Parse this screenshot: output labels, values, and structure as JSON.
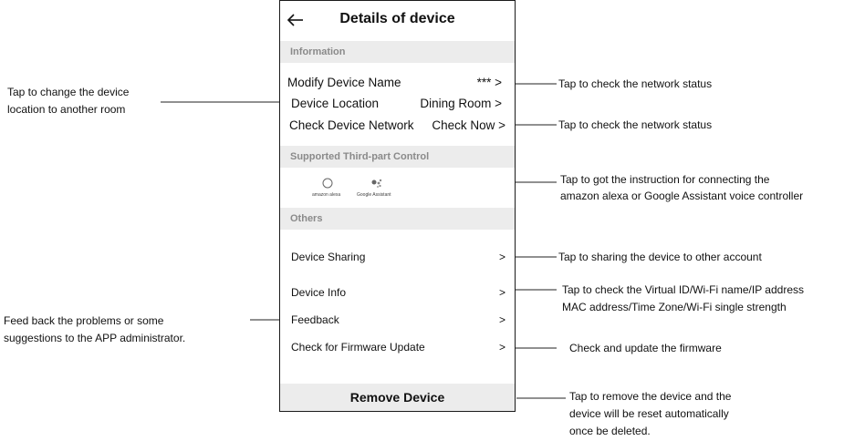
{
  "screen": {
    "title": "Details of device",
    "back_icon": "arrow-left-icon",
    "sections": {
      "information": "Information",
      "third_party": "Supported Third-part Control",
      "others": "Others"
    },
    "information_rows": [
      {
        "label": "Modify Device Name",
        "value": "*** >"
      },
      {
        "label": "Device Location",
        "value": "Dining Room >"
      },
      {
        "label": "Check Device Network",
        "value": "Check Now >"
      }
    ],
    "voice": {
      "alexa": "amazon alexa",
      "google": "Google Assistant"
    },
    "others_rows": [
      {
        "label": "Device Sharing",
        "chevron": ">"
      },
      {
        "label": "Device Info",
        "chevron": ">"
      },
      {
        "label": "Feedback",
        "chevron": ">"
      },
      {
        "label": "Check for Firmware Update",
        "chevron": ">"
      }
    ],
    "remove_button": "Remove Device"
  },
  "annotations": {
    "modify_name": "Tap to check the network status",
    "location_line1": "Tap to change the device",
    "location_line2": "location to another room",
    "check_network": "Tap to check the network status",
    "third_party_line1": "Tap to got the instruction for connecting the",
    "third_party_line2": "amazon alexa or Google Assistant voice controller",
    "sharing": "Tap to sharing the device to other account",
    "device_info_line1": "Tap to check the Virtual ID/Wi-Fi name/IP address",
    "device_info_line2": "MAC address/Time Zone/Wi-Fi single strength",
    "feedback_line1": "Feed back the problems or some",
    "feedback_line2": "suggestions to the APP administrator.",
    "firmware": "Check and update the firmware",
    "remove_line1": "Tap to remove the device and the",
    "remove_line2": "device will be reset automatically",
    "remove_line3": "once be deleted."
  }
}
